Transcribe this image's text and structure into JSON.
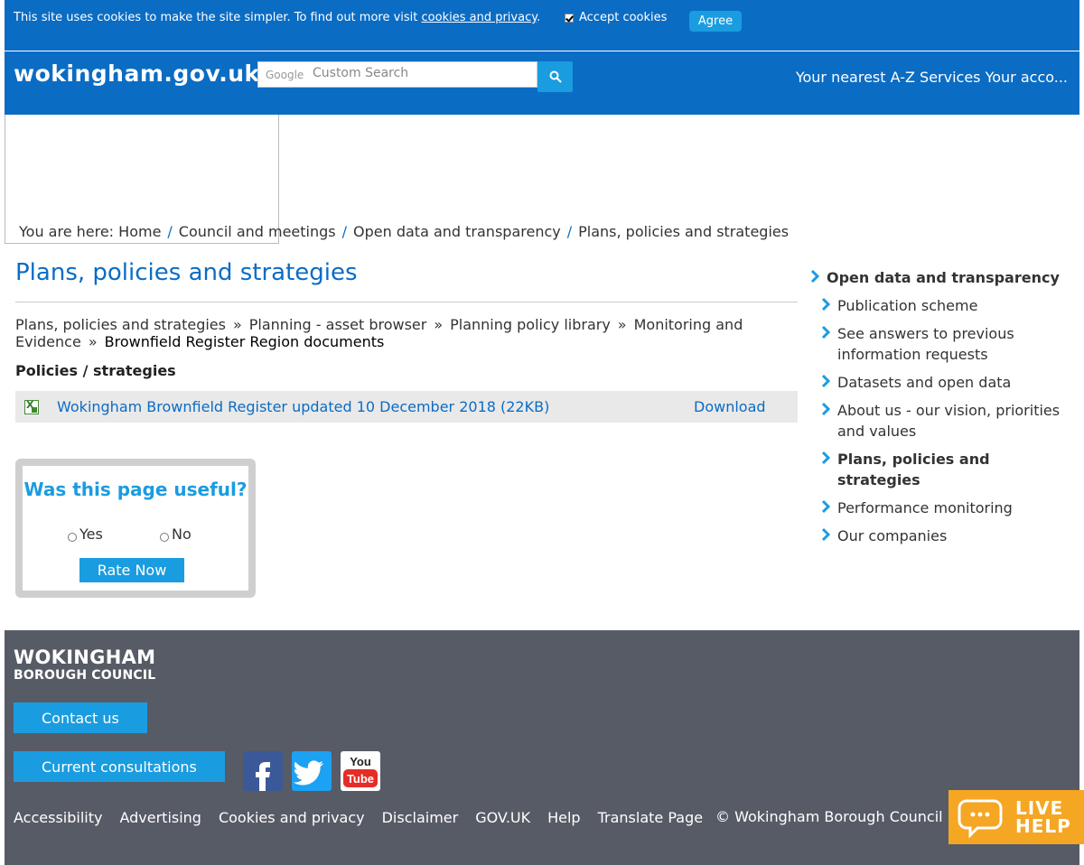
{
  "cookie": {
    "text": "This site uses cookies to make the site simpler. To find out more visit ",
    "link": "cookies and privacy",
    "end": ".",
    "accept_label": "Accept cookies",
    "agree_label": "Agree"
  },
  "header": {
    "logo": "wokingham.gov.uk",
    "search_brand": "Google",
    "search_placeholder": "Custom Search",
    "links": "Your nearest A-Z Services Your acco..."
  },
  "breadcrumb": {
    "prefix": "You are here: ",
    "items": [
      "Home",
      "Council and meetings",
      "Open data and transparency",
      "Plans, policies and strategies"
    ]
  },
  "main": {
    "title": "Plans, policies and strategies",
    "sub_crumb": [
      "Plans, policies and strategies",
      "Planning - asset browser",
      "Planning policy library",
      "Monitoring and Evidence",
      "Brownfield Register Region documents"
    ],
    "section_label": "Policies / strategies",
    "document": {
      "title": "Wokingham Brownfield Register updated 10 December 2018 (22KB)",
      "download": "Download"
    }
  },
  "feedback": {
    "title": "Was this page useful?",
    "yes": "Yes",
    "no": "No",
    "button": "Rate Now"
  },
  "side_nav": {
    "heading": "Open data and transparency",
    "items": [
      "Publication scheme",
      "See answers to previous information requests",
      "Datasets and open data",
      "About us - our vision, priorities and values",
      "Plans, policies and strategies",
      "Performance monitoring",
      "Our companies"
    ]
  },
  "footer": {
    "logo_line1": "WOKINGHAM",
    "logo_line2": "BOROUGH COUNCIL",
    "contact": "Contact us",
    "consultations": "Current consultations",
    "links": [
      "Accessibility",
      "Advertising",
      "Cookies and privacy",
      "Disclaimer",
      "GOV.UK",
      "Help",
      "Translate Page"
    ],
    "copyright": "© Wokingham Borough Council"
  },
  "live_help": {
    "line1": "LIVE",
    "line2": "HELP"
  },
  "colors": {
    "brand_blue": "#0b6cc4",
    "accent_blue": "#1a9ce0",
    "footer_grey": "#575b66",
    "live_help_orange": "#f5a623"
  }
}
